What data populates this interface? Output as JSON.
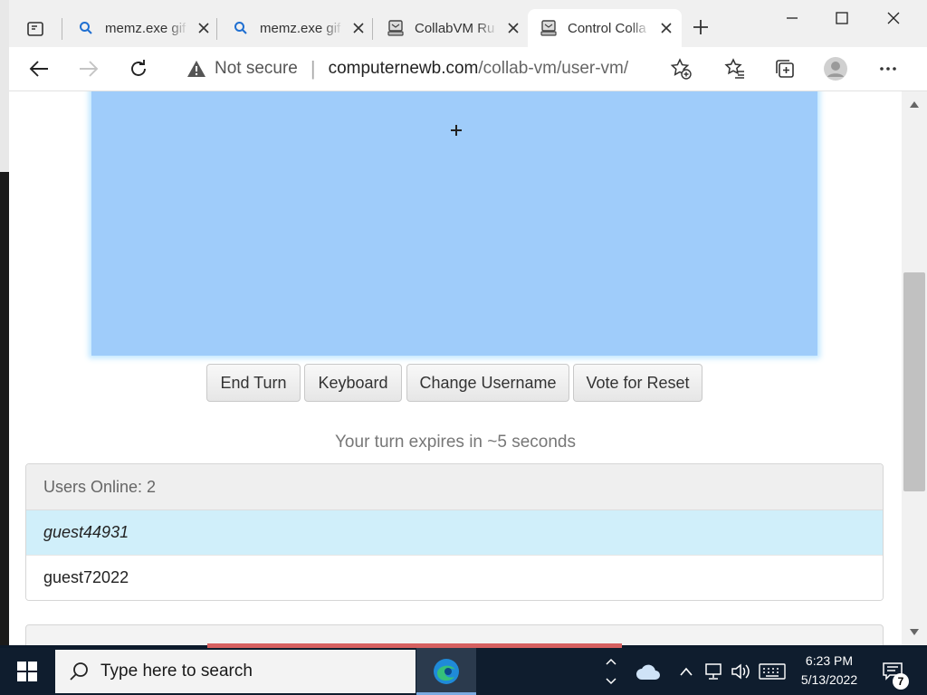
{
  "browser": {
    "tabs": [
      {
        "title": "memz.exe gif",
        "icon": "search-icon"
      },
      {
        "title": "memz.exe gif",
        "icon": "search-icon"
      },
      {
        "title": "CollabVM Ru",
        "icon": "collabvm-icon"
      },
      {
        "title": "Control Colla",
        "icon": "collabvm-icon"
      }
    ],
    "address": {
      "security_label": "Not secure",
      "domain": "computernewb.com",
      "path": "/collab-vm/user-vm/"
    }
  },
  "vm": {
    "buttons": {
      "end_turn": "End Turn",
      "keyboard": "Keyboard",
      "change_username": "Change Username",
      "vote_reset": "Vote for Reset"
    },
    "turn_message": "Your turn expires in ~5 seconds",
    "users": {
      "header": "Users Online: 2",
      "list": [
        "guest44931",
        "guest72022"
      ]
    }
  },
  "taskbar": {
    "search_placeholder": "Type here to search",
    "time": "6:23 PM",
    "date": "5/13/2022",
    "notification_count": "7"
  },
  "colors": {
    "vm_screen": "#9fccfa",
    "current_user_highlight": "#d0effa",
    "taskbar": "#0f1d2e"
  }
}
